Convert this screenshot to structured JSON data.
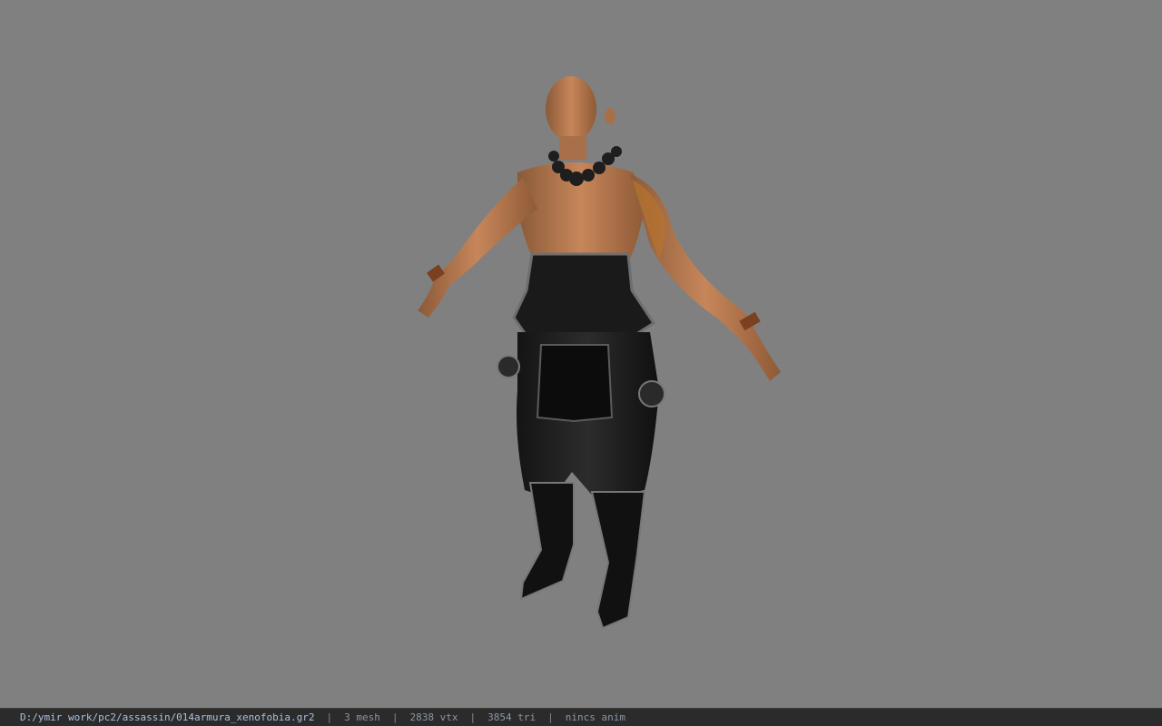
{
  "viewport": {
    "background": "#808080",
    "model_icon": "character-model-icon"
  },
  "statusbar": {
    "file_path": "D:/ymir work/pc2/assassin/014armura_xenofobia.gr2",
    "separator": "|",
    "mesh_count": "3 mesh",
    "vertex_count": "2838 vtx",
    "triangle_count": "3854 tri",
    "animation": "nincs anim"
  }
}
